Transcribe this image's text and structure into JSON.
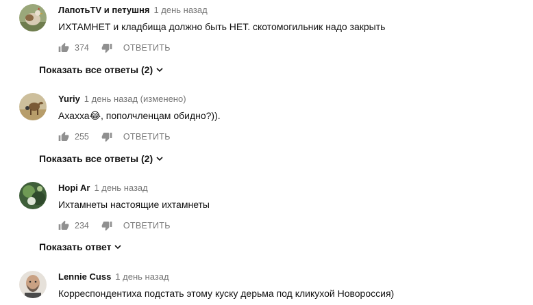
{
  "comments": [
    {
      "author": "ЛапотьTV и петушня",
      "time": "1 день назад",
      "text": "ИХТАМНЕТ и кладбища должно быть НЕТ. скотомогильник надо закрыть",
      "likes": "374",
      "reply_label": "ОТВЕТИТЬ",
      "show_replies": "Показать все ответы (2)",
      "avatar_icon": "rooster-avatar"
    },
    {
      "author": "Yuriy",
      "time": "1 день назад (изменено)",
      "text": "Ахахха😂, пополчленцам обидно?)).",
      "likes": "255",
      "reply_label": "ОТВЕТИТЬ",
      "show_replies": "Показать все ответы (2)",
      "avatar_icon": "camel-desert-avatar"
    },
    {
      "author": "Hopi Ar",
      "time": "1 день назад",
      "text": "Ихтамнеты настоящие ихтамнеты",
      "likes": "234",
      "reply_label": "ОТВЕТИТЬ",
      "show_replies": "Показать ответ",
      "avatar_icon": "nature-avatar"
    },
    {
      "author": "Lennie Cuss",
      "time": "1 день назад",
      "text": "Корреспондентиха подстать этому куску дерьма под кликухой Новороссия)",
      "avatar_icon": "bald-man-avatar"
    }
  ],
  "colors": {
    "text": "#111111",
    "meta": "#767676",
    "background": "#ffffff"
  }
}
